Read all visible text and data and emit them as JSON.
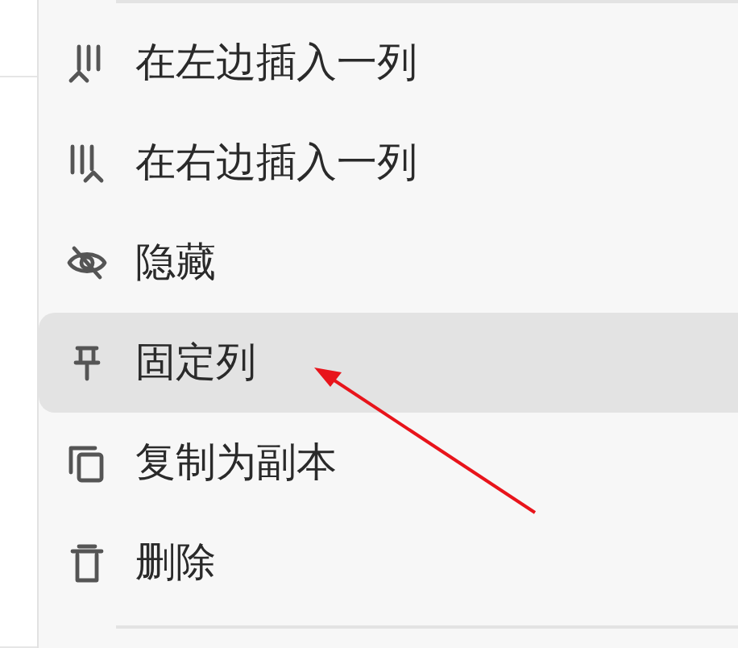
{
  "menu": {
    "items": [
      {
        "kind": "insert-left",
        "label": "在左边插入一列",
        "selected": false
      },
      {
        "kind": "insert-right",
        "label": "在右边插入一列",
        "selected": false
      },
      {
        "kind": "hide",
        "label": "隐藏",
        "selected": false
      },
      {
        "kind": "pin",
        "label": "固定列",
        "selected": true
      },
      {
        "kind": "copy",
        "label": "复制为副本",
        "selected": false
      },
      {
        "kind": "delete",
        "label": "删除",
        "selected": false
      }
    ]
  }
}
